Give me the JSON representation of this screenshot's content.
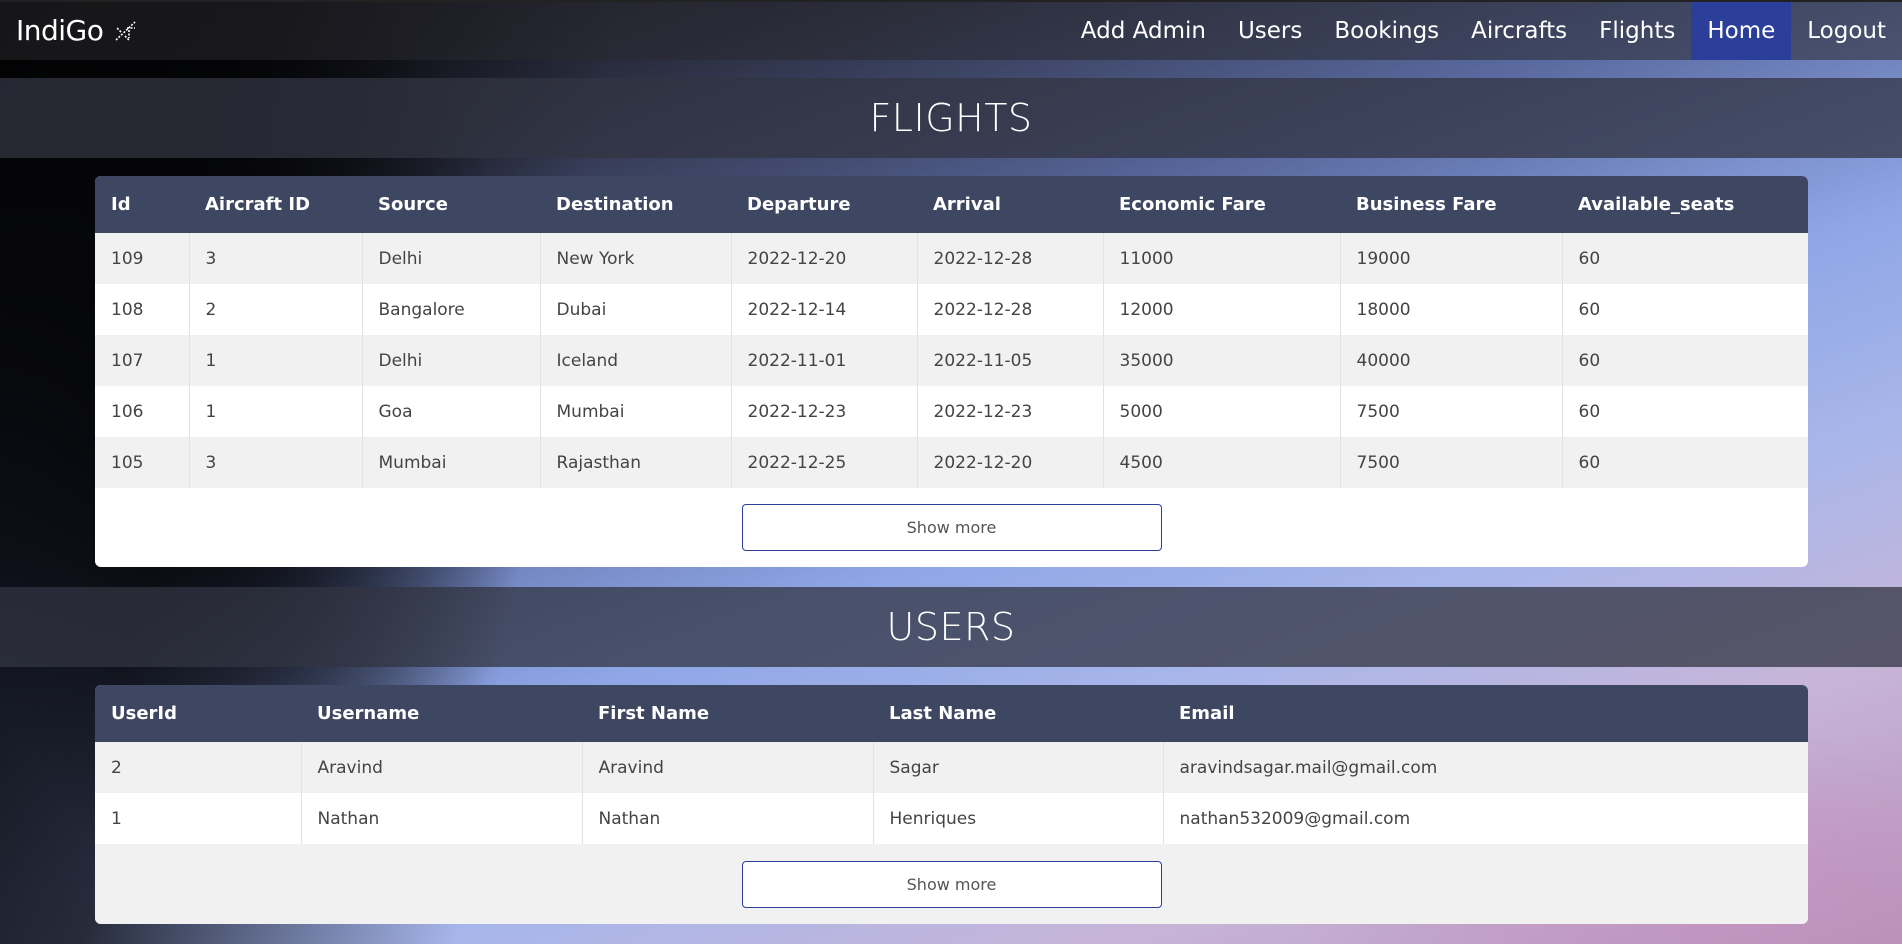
{
  "brand": {
    "name": "IndiGo",
    "icon": "airplane-icon"
  },
  "nav": [
    {
      "label": "Add Admin",
      "active": false
    },
    {
      "label": "Users",
      "active": false
    },
    {
      "label": "Bookings",
      "active": false
    },
    {
      "label": "Aircrafts",
      "active": false
    },
    {
      "label": "Flights",
      "active": false
    },
    {
      "label": "Home",
      "active": true
    },
    {
      "label": "Logout",
      "active": false
    }
  ],
  "colors": {
    "nav_active": "#2b3e9a",
    "table_header": "#3e4761"
  },
  "flights": {
    "title": "FLIGHTS",
    "columns": [
      "Id",
      "Aircraft ID",
      "Source",
      "Destination",
      "Departure",
      "Arrival",
      "Economic Fare",
      "Business Fare",
      "Available_seats"
    ],
    "rows": [
      [
        "109",
        "3",
        "Delhi",
        "New York",
        "2022-12-20",
        "2022-12-28",
        "11000",
        "19000",
        "60"
      ],
      [
        "108",
        "2",
        "Bangalore",
        "Dubai",
        "2022-12-14",
        "2022-12-28",
        "12000",
        "18000",
        "60"
      ],
      [
        "107",
        "1",
        "Delhi",
        "Iceland",
        "2022-11-01",
        "2022-11-05",
        "35000",
        "40000",
        "60"
      ],
      [
        "106",
        "1",
        "Goa",
        "Mumbai",
        "2022-12-23",
        "2022-12-23",
        "5000",
        "7500",
        "60"
      ],
      [
        "105",
        "3",
        "Mumbai",
        "Rajasthan",
        "2022-12-25",
        "2022-12-20",
        "4500",
        "7500",
        "60"
      ]
    ],
    "show_more": "Show more"
  },
  "users": {
    "title": "USERS",
    "columns": [
      "UserId",
      "Username",
      "First Name",
      "Last Name",
      "Email"
    ],
    "rows": [
      [
        "2",
        "Aravind",
        "Aravind",
        "Sagar",
        "aravindsagar.mail@gmail.com"
      ],
      [
        "1",
        "Nathan",
        "Nathan",
        "Henriques",
        "nathan532009@gmail.com"
      ]
    ],
    "show_more": "Show more"
  }
}
